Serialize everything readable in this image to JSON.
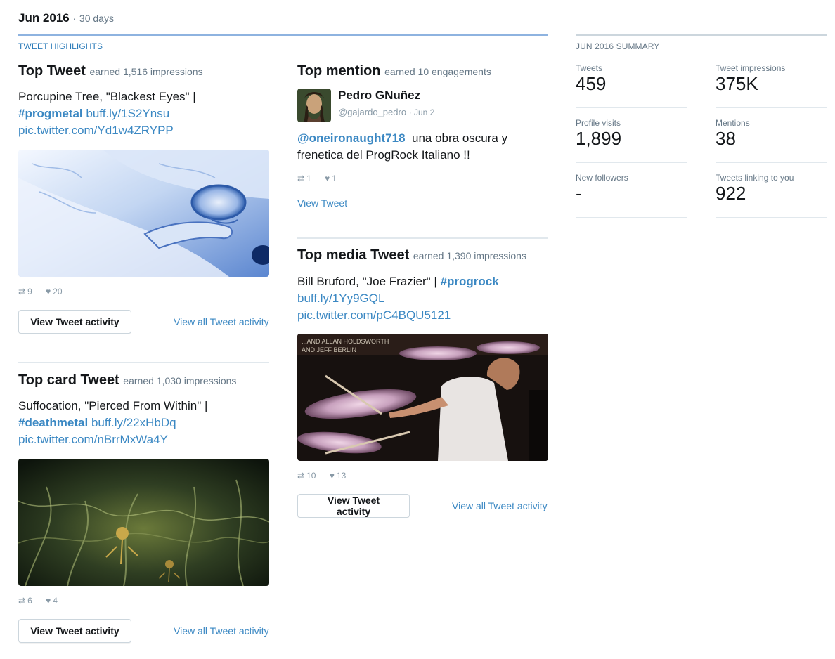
{
  "header": {
    "period": "Jun 2016",
    "sep": "·",
    "days": "30 days"
  },
  "highlights_label": "TWEET HIGHLIGHTS",
  "summary_label": "JUN 2016 SUMMARY",
  "colors": {
    "accent": "#3b88c3",
    "highlight_rule": "#8eb3e0"
  },
  "top_tweet": {
    "title": "Top Tweet",
    "earned": "earned 1,516 impressions",
    "text_plain": "Porcupine Tree, \"Blackest Eyes\" |",
    "hashtag": "#progmetal",
    "link1": "buff.ly/1S2Ynsu",
    "link2": "pic.twitter.com/Yd1w4ZRYPP",
    "retweets": "9",
    "likes": "20",
    "button": "View Tweet activity",
    "view_all": "View all Tweet activity"
  },
  "top_mention": {
    "title": "Top mention",
    "earned": "earned 10 engagements",
    "user_name": "Pedro GNuñez",
    "handle": "@gajardo_pedro",
    "date": "· Jun 2",
    "mention": "@oneironaught718",
    "text_rest": "una obra oscura y frenetica del ProgRock Italiano !!",
    "retweets": "1",
    "likes": "1",
    "view_link": "View Tweet"
  },
  "top_media": {
    "title": "Top media Tweet",
    "earned": "earned 1,390 impressions",
    "text_plain": "Bill Bruford, \"Joe Frazier\" |",
    "hashtag": "#progrock",
    "link1": "buff.ly/1Yy9GQL",
    "link2": "pic.twitter.com/pC4BQU5121",
    "retweets": "10",
    "likes": "13",
    "button": "View Tweet activity",
    "view_all": "View all Tweet activity",
    "album_text1": "...AND ALLAN HOLDSWORTH",
    "album_text2": "AND JEFF BERLIN"
  },
  "top_card": {
    "title": "Top card Tweet",
    "earned": "earned 1,030 impressions",
    "text_plain": "Suffocation, \"Pierced From Within\" |",
    "hashtag": "#deathmetal",
    "link1": "buff.ly/22xHbDq",
    "link2": "pic.twitter.com/nBrrMxWa4Y",
    "retweets": "6",
    "likes": "4",
    "button": "View Tweet activity",
    "view_all": "View all Tweet activity"
  },
  "summary": [
    {
      "label": "Tweets",
      "value": "459"
    },
    {
      "label": "Tweet impressions",
      "value": "375K"
    },
    {
      "label": "Profile visits",
      "value": "1,899"
    },
    {
      "label": "Mentions",
      "value": "38"
    },
    {
      "label": "New followers",
      "value": "-"
    },
    {
      "label": "Tweets linking to you",
      "value": "922"
    }
  ],
  "icons": {
    "retweet": "retweet-icon",
    "like": "heart-icon"
  }
}
